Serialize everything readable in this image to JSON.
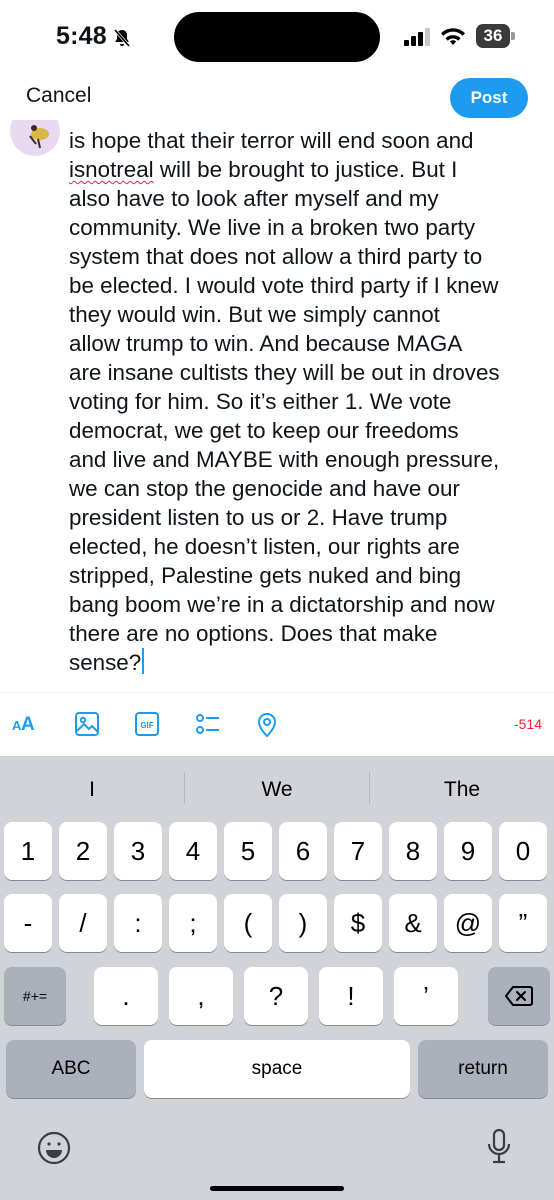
{
  "status_bar": {
    "time": "5:48",
    "battery": "36"
  },
  "header": {
    "cancel_label": "Cancel",
    "post_label": "Post"
  },
  "compose": {
    "lines": [
      "is hope that their terror will end soon and",
      " will be brought to justice. But I",
      "also have to look after myself and my",
      "community. We live in a broken two party",
      "system that does not allow a third party to",
      "be elected. I would vote third party if I knew",
      "they would win. But we simply cannot",
      "allow trump to win. And because MAGA",
      "are insane cultists they will be out in droves",
      "voting for him. So it’s either 1. We vote",
      "democrat, we get to keep our freedoms",
      "and live and MAYBE with enough pressure,",
      "we can stop the genocide and have our",
      "president listen to us or 2. Have trump",
      "elected, he doesn’t listen, our rights are",
      "stripped, Palestine gets nuked and bing",
      "bang boom we’re in a dictatorship and now",
      "there are no options. Does that make",
      "sense?"
    ],
    "misspelled_word": "isnotreal"
  },
  "toolbar": {
    "text_size_label": "AA",
    "gif_label": "GIF",
    "char_count": "-514",
    "icons": [
      "text-size-icon",
      "image-icon",
      "gif-icon",
      "poll-icon",
      "location-icon"
    ],
    "accent_color": "#1d9bf0",
    "over_limit_color": "#f4212e"
  },
  "keyboard": {
    "suggestions": [
      "I",
      "We",
      "The"
    ],
    "row1": [
      "1",
      "2",
      "3",
      "4",
      "5",
      "6",
      "7",
      "8",
      "9",
      "0"
    ],
    "row2": [
      "-",
      "/",
      ":",
      ";",
      "(",
      ")",
      "$",
      "&",
      "@",
      "”"
    ],
    "symbols_toggle": "#+=",
    "row3": [
      ".",
      ",",
      "?",
      "!",
      "’"
    ],
    "abc_label": "ABC",
    "space_label": "space",
    "return_label": "return"
  }
}
